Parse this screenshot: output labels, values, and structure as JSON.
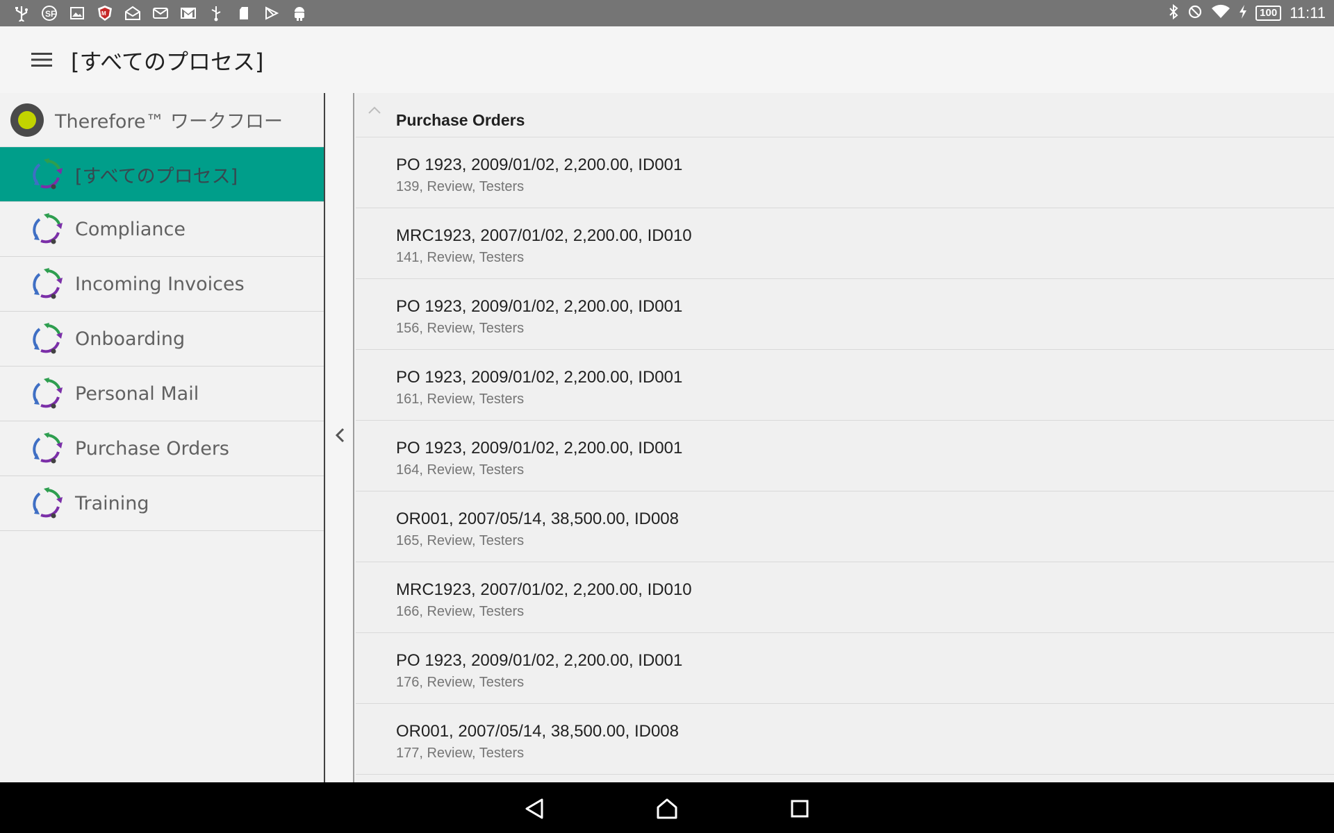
{
  "status_bar": {
    "left_icons": [
      "usb-icon",
      "sf-app-icon",
      "image-icon",
      "mcafee-icon",
      "mail-open-icon",
      "email-icon",
      "gmail-icon",
      "usb-debug-icon",
      "sd-card-icon",
      "play-store-icon",
      "android-icon"
    ],
    "battery": "100",
    "time": "11:11"
  },
  "app_bar": {
    "title": "[すべてのプロセス]"
  },
  "sidebar": {
    "header": "Therefore™ ワークフロー",
    "items": [
      {
        "label": "[すべてのプロセス]",
        "active": true
      },
      {
        "label": "Compliance"
      },
      {
        "label": "Incoming Invoices"
      },
      {
        "label": "Onboarding"
      },
      {
        "label": "Personal Mail"
      },
      {
        "label": "Purchase Orders"
      },
      {
        "label": "Training"
      }
    ]
  },
  "list": {
    "group_title": "Purchase Orders",
    "rows": [
      {
        "title": "PO 1923, 2009/01/02, 2,200.00, ID001",
        "sub": "139, Review, Testers"
      },
      {
        "title": "MRC1923, 2007/01/02, 2,200.00, ID010",
        "sub": "141, Review, Testers"
      },
      {
        "title": "PO 1923, 2009/01/02, 2,200.00, ID001",
        "sub": "156, Review, Testers"
      },
      {
        "title": "PO 1923, 2009/01/02, 2,200.00, ID001",
        "sub": "161, Review, Testers"
      },
      {
        "title": "PO 1923, 2009/01/02, 2,200.00, ID001",
        "sub": "164, Review, Testers"
      },
      {
        "title": "OR001, 2007/05/14, 38,500.00, ID008",
        "sub": "165, Review, Testers"
      },
      {
        "title": "MRC1923, 2007/01/02, 2,200.00, ID010",
        "sub": "166, Review, Testers"
      },
      {
        "title": "PO 1923, 2009/01/02, 2,200.00, ID001",
        "sub": "176, Review, Testers"
      },
      {
        "title": "OR001, 2007/05/14, 38,500.00, ID008",
        "sub": "177, Review, Testers"
      }
    ]
  },
  "colors": {
    "accent": "#009e8a",
    "status_bar": "#757575",
    "logo_dot": "#c2d400"
  }
}
